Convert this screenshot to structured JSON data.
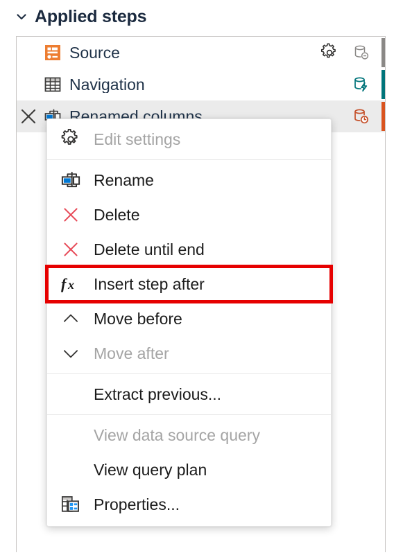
{
  "header": {
    "title": "Applied steps",
    "collapse_icon": "chevron-down-icon",
    "title_color": "#1b2a3f"
  },
  "steps_panel": {
    "border_color": "#c8c6c4",
    "selected_row_bg": "#ebebeb",
    "rows": [
      {
        "label": "Source",
        "icon": "source-step-icon",
        "icon_color": "#ed7d31",
        "has_gear": true,
        "gear_icon": "gear-icon",
        "fold_icon": "folding-not-supported-icon",
        "fold_color": "#8a8886",
        "selected": false,
        "show_delete": false
      },
      {
        "label": "Navigation",
        "icon": "table-step-icon",
        "icon_color": "#3b3a39",
        "has_gear": false,
        "gear_icon": "",
        "fold_icon": "folding-supported-icon",
        "fold_color": "#00747a",
        "selected": false,
        "show_delete": false
      },
      {
        "label": "Renamed columns",
        "icon": "rename-columns-step-icon",
        "icon_color": "#0078d4",
        "has_gear": false,
        "gear_icon": "",
        "fold_icon": "folding-pending-icon",
        "fold_color": "#c5502a",
        "selected": true,
        "show_delete": true,
        "delete_icon": "close-icon"
      }
    ]
  },
  "context_menu": {
    "highlight_color": "#e60000",
    "items": [
      {
        "label": "Edit settings",
        "icon": "gear-icon",
        "disabled": true,
        "highlighted": false,
        "sep_after": true
      },
      {
        "label": "Rename",
        "icon": "rename-icon",
        "disabled": false,
        "highlighted": false,
        "sep_after": false
      },
      {
        "label": "Delete",
        "icon": "delete-x-icon",
        "disabled": false,
        "highlighted": false,
        "sep_after": false
      },
      {
        "label": "Delete until end",
        "icon": "delete-x-icon",
        "disabled": false,
        "highlighted": false,
        "sep_after": false
      },
      {
        "label": "Insert step after",
        "icon": "fx-function-icon",
        "disabled": false,
        "highlighted": true,
        "sep_after": false
      },
      {
        "label": "Move before",
        "icon": "chevron-up-icon",
        "disabled": false,
        "highlighted": false,
        "sep_after": false
      },
      {
        "label": "Move after",
        "icon": "chevron-down-icon",
        "disabled": true,
        "highlighted": false,
        "sep_after": true
      },
      {
        "label": "Extract previous...",
        "icon": "",
        "disabled": false,
        "highlighted": false,
        "sep_after": true
      },
      {
        "label": "View data source query",
        "icon": "",
        "disabled": true,
        "highlighted": false,
        "sep_after": false
      },
      {
        "label": "View query plan",
        "icon": "",
        "disabled": false,
        "highlighted": false,
        "sep_after": false
      },
      {
        "label": "Properties...",
        "icon": "properties-icon",
        "disabled": false,
        "highlighted": false,
        "sep_after": false
      }
    ]
  }
}
